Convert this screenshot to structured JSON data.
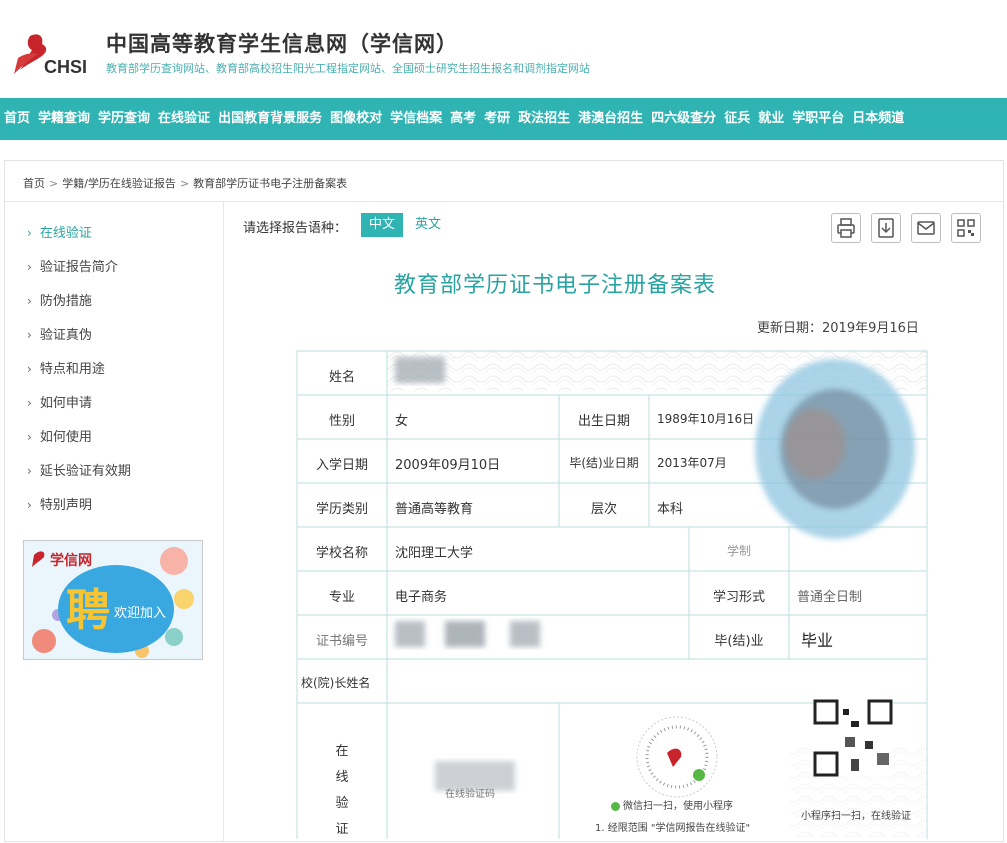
{
  "header": {
    "logo_text": "CHSI",
    "site_title": "中国高等教育学生信息网（学信网）",
    "subtitle": "教育部学历查询网站、教育部高校招生阳光工程指定网站、全国硕士研究生招生报名和调剂指定网站"
  },
  "nav": [
    "首页",
    "学籍查询",
    "学历查询",
    "在线验证",
    "出国教育背景服务",
    "图像校对",
    "学信档案",
    "高考",
    "考研",
    "政法招生",
    "港澳台招生",
    "四六级查分",
    "征兵",
    "就业",
    "学职平台",
    "日本频道"
  ],
  "breadcrumb": [
    "首页",
    "学籍/学历在线验证报告",
    "教育部学历证书电子注册备案表"
  ],
  "sidebar": {
    "items": [
      "在线验证",
      "验证报告简介",
      "防伪措施",
      "验证真伪",
      "特点和用途",
      "如何申请",
      "如何使用",
      "延长验证有效期",
      "特别声明"
    ],
    "active": "在线验证",
    "banner_brand": "学信网",
    "banner_big": "聘",
    "banner_small": "欢迎加入"
  },
  "report": {
    "lang_label": "请选择报告语种：",
    "lang_zh": "中文",
    "lang_en": "英文",
    "tools": [
      "printer-icon",
      "download-icon",
      "mail-icon",
      "qrcode-icon"
    ],
    "title": "教育部学历证书电子注册备案表",
    "updated": "更新日期：2019年9月16日",
    "fields": {
      "name_label": "姓名",
      "gender_label": "性别",
      "gender": "女",
      "birth_label": "出生日期",
      "birth": "1989年10月16日",
      "enroll_label": "入学日期",
      "enroll": "2009年09月10日",
      "grad_date_label": "毕(结)业日期",
      "grad_date": "2013年07月",
      "edu_type_label": "学历类别",
      "edu_type": "普通高等教育",
      "level_label": "层次",
      "level": "本科",
      "school_label": "学校名称",
      "school": "沈阳理工大学",
      "duration_label": "学制",
      "major_label": "专业",
      "major": "电子商务",
      "form_label": "学习形式",
      "form": "普通全日制",
      "cert_label": "证书编号",
      "grad_label": "毕(结)业",
      "grad": "毕业",
      "president_label": "校(院)长姓名",
      "verify_label_chars": [
        "在",
        "线",
        "验",
        "证"
      ],
      "verify_code_text": "在线验证码",
      "wechat_text": "微信扫一扫，使用小程序",
      "mini_text": "小程序扫一扫，在线验证",
      "footer_note": "1. 经限范围 \"学信网报告在线验证\""
    }
  }
}
